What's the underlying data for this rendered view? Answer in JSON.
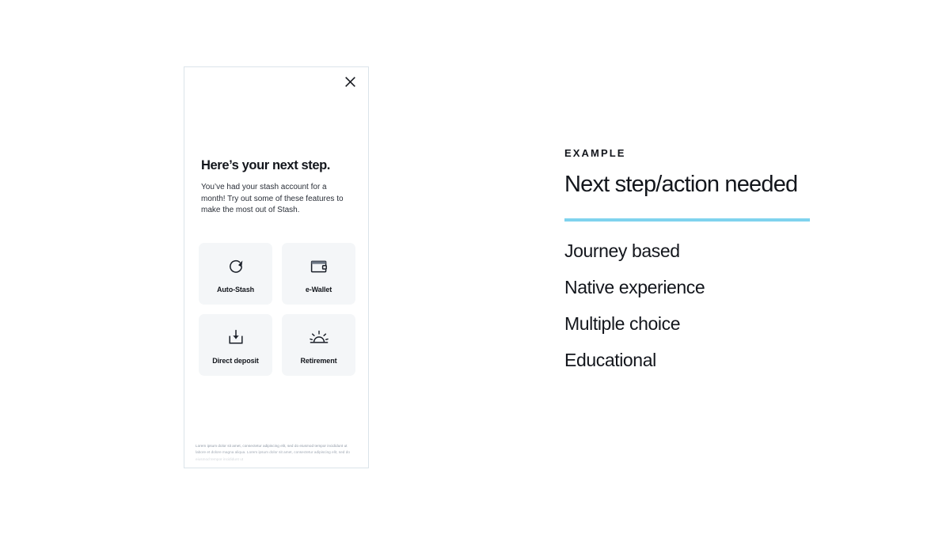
{
  "mock": {
    "close_icon": "close-icon",
    "headline": "Here’s your next step.",
    "subcopy": "You’ve had your stash account for a month! Try out some of these features to make the most out of Stash.",
    "tiles": [
      {
        "label": "Auto-Stash",
        "icon": "refresh-circle-icon"
      },
      {
        "label": "e-Wallet",
        "icon": "wallet-icon"
      },
      {
        "label": "Direct deposit",
        "icon": "download-tray-icon"
      },
      {
        "label": "Retirement",
        "icon": "sunrise-icon"
      }
    ],
    "fineprint": "Lorem ipsum dolor sit amet, consectetur adipiscing elit, sed do eiusmod tempor incididunt ut labore et dolore magna aliqua. Lorem ipsum dolor sit amet, consectetur adipiscing elit, sed do eiusmod tempor incididunt ut"
  },
  "panel": {
    "eyebrow": "EXAMPLE",
    "title": "Next step/action needed",
    "divider_color": "#7fd3ee",
    "features": [
      "Journey based",
      "Native experience",
      "Multiple choice",
      "Educational"
    ]
  }
}
